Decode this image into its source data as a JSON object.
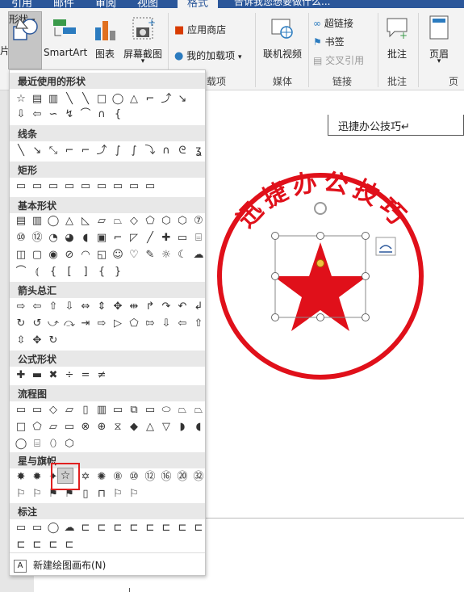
{
  "top_tabs": [
    "引用",
    "邮件",
    "审阅",
    "视图",
    "格式"
  ],
  "tell_me": "告诉我您想要做什么...",
  "ribbon": {
    "shapes_label": "形状",
    "smartart_label": "SmartArt",
    "chart_label": "图表",
    "screenshot_label": "屏幕截图",
    "app_store_label": "应用商店",
    "my_addins_label": "我的加载项",
    "addins_group": "载项",
    "online_video_label": "联机视频",
    "media_group": "媒体",
    "hyperlink_label": "超链接",
    "bookmark_label": "书签",
    "crossref_label": "交叉引用",
    "links_group": "链接",
    "comment_label": "批注",
    "comments_group": "批注",
    "header_label": "页眉",
    "headerfooter_group": "页眉",
    "left_cut_label": "片"
  },
  "document": {
    "textbox_text": "迅捷办公技巧↵",
    "seal_text": "迅捷办公技巧",
    "seal_color": "#e0101a"
  },
  "shapes_menu": {
    "sections": [
      "最近使用的形状",
      "线条",
      "矩形",
      "基本形状",
      "箭头总汇",
      "公式形状",
      "流程图",
      "星与旗帜",
      "标注"
    ],
    "new_canvas": "新建绘图画布(N)"
  }
}
